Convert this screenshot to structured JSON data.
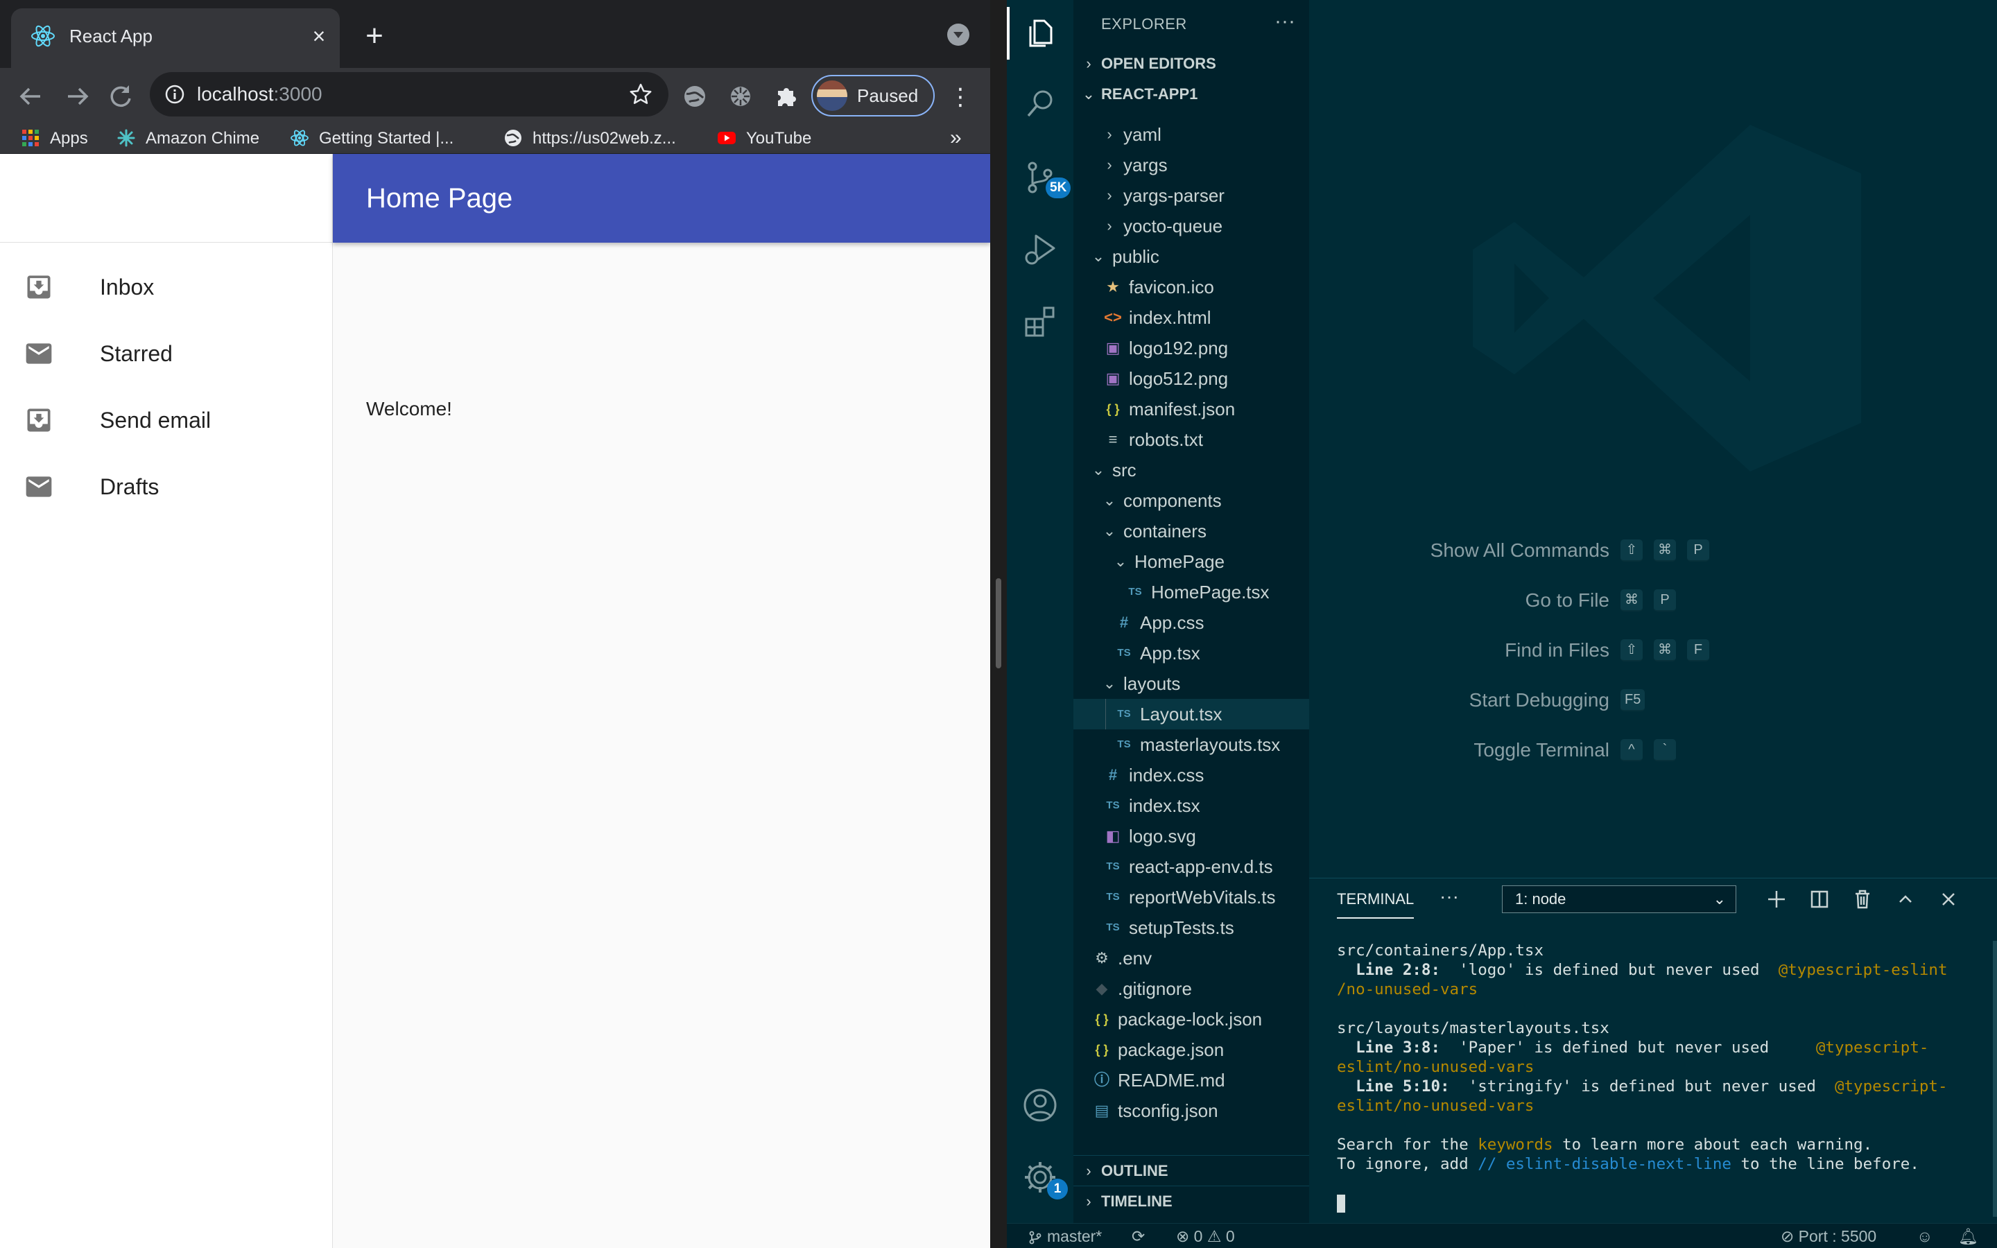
{
  "browser": {
    "tab_title": "React App",
    "new_tab_symbol": "+",
    "url_host": "localhost",
    "url_port": ":3000",
    "profile_status": "Paused",
    "bookmarks": [
      {
        "label": "Apps",
        "icon": "apps-grid-icon"
      },
      {
        "label": "Amazon Chime",
        "icon": "amazon-chime-icon"
      },
      {
        "label": "Getting Started |...",
        "icon": "react-icon"
      },
      {
        "label": "https://us02web.z...",
        "icon": "globe-icon"
      },
      {
        "label": "YouTube",
        "icon": "youtube-icon"
      }
    ],
    "bookmarks_more": "»"
  },
  "app": {
    "appbar_title": "Home Page",
    "welcome": "Welcome!",
    "drawer_items": [
      {
        "label": "Inbox",
        "icon": "inbox-icon"
      },
      {
        "label": "Starred",
        "icon": "mail-icon"
      },
      {
        "label": "Send email",
        "icon": "inbox-icon"
      },
      {
        "label": "Drafts",
        "icon": "mail-icon"
      }
    ]
  },
  "vscode": {
    "explorer_title": "EXPLORER",
    "sections": {
      "open_editors": "OPEN EDITORS",
      "project": "REACT-APP1",
      "outline": "OUTLINE",
      "timeline": "TIMELINE"
    },
    "source_control_badge": "5K",
    "settings_badge": "1",
    "tree": [
      {
        "label": "yaml",
        "type": "folder",
        "depth": 2,
        "expanded": false
      },
      {
        "label": "yargs",
        "type": "folder",
        "depth": 2,
        "expanded": false
      },
      {
        "label": "yargs-parser",
        "type": "folder",
        "depth": 2,
        "expanded": false
      },
      {
        "label": "yocto-queue",
        "type": "folder",
        "depth": 2,
        "expanded": false
      },
      {
        "label": "public",
        "type": "folder",
        "depth": 1,
        "expanded": true
      },
      {
        "label": "favicon.ico",
        "type": "favicon",
        "depth": 2
      },
      {
        "label": "index.html",
        "type": "html",
        "depth": 2
      },
      {
        "label": "logo192.png",
        "type": "image",
        "depth": 2
      },
      {
        "label": "logo512.png",
        "type": "image",
        "depth": 2
      },
      {
        "label": "manifest.json",
        "type": "json",
        "depth": 2
      },
      {
        "label": "robots.txt",
        "type": "text",
        "depth": 2
      },
      {
        "label": "src",
        "type": "folder",
        "depth": 1,
        "expanded": true
      },
      {
        "label": "components",
        "type": "folder",
        "depth": 2,
        "expanded": true
      },
      {
        "label": "containers",
        "type": "folder",
        "depth": 2,
        "expanded": true
      },
      {
        "label": "HomePage",
        "type": "folder",
        "depth": 3,
        "expanded": true
      },
      {
        "label": "HomePage.tsx",
        "type": "ts",
        "depth": 4
      },
      {
        "label": "App.css",
        "type": "css",
        "depth": 3
      },
      {
        "label": "App.tsx",
        "type": "ts",
        "depth": 3
      },
      {
        "label": "layouts",
        "type": "folder",
        "depth": 2,
        "expanded": true
      },
      {
        "label": "Layout.tsx",
        "type": "ts",
        "depth": 3,
        "selected": true
      },
      {
        "label": "masterlayouts.tsx",
        "type": "ts",
        "depth": 3
      },
      {
        "label": "index.css",
        "type": "css",
        "depth": 2
      },
      {
        "label": "index.tsx",
        "type": "ts",
        "depth": 2
      },
      {
        "label": "logo.svg",
        "type": "svg",
        "depth": 2
      },
      {
        "label": "react-app-env.d.ts",
        "type": "ts",
        "depth": 2
      },
      {
        "label": "reportWebVitals.ts",
        "type": "ts",
        "depth": 2
      },
      {
        "label": "setupTests.ts",
        "type": "ts",
        "depth": 2
      },
      {
        "label": ".env",
        "type": "gear",
        "depth": 1
      },
      {
        "label": ".gitignore",
        "type": "git",
        "depth": 1
      },
      {
        "label": "package-lock.json",
        "type": "json",
        "depth": 1
      },
      {
        "label": "package.json",
        "type": "json",
        "depth": 1
      },
      {
        "label": "README.md",
        "type": "info",
        "depth": 1
      },
      {
        "label": "tsconfig.json",
        "type": "tsconfig",
        "depth": 1
      }
    ],
    "commands": [
      {
        "label": "Show All Commands",
        "keys": [
          "⇧",
          "⌘",
          "P"
        ]
      },
      {
        "label": "Go to File",
        "keys": [
          "⌘",
          "P"
        ]
      },
      {
        "label": "Find in Files",
        "keys": [
          "⇧",
          "⌘",
          "F"
        ]
      },
      {
        "label": "Start Debugging",
        "keys": [
          "F5"
        ]
      },
      {
        "label": "Toggle Terminal",
        "keys": [
          "^",
          "`"
        ]
      }
    ],
    "panel": {
      "tab": "TERMINAL",
      "more": "···",
      "terminal_select": "1: node"
    },
    "terminal": {
      "l1": "src/containers/App.tsx",
      "l2a": "  Line 2:8:",
      "l2b": "  'logo' is defined but never used  ",
      "l2c": "@typescript-eslint",
      "l3": "/no-unused-vars",
      "l5": "src/layouts/masterlayouts.tsx",
      "l6a": "  Line 3:8:",
      "l6b": "  'Paper' is defined but never used     ",
      "l6c": "@typescript-",
      "l7": "eslint/no-unused-vars",
      "l8a": "  Line 5:10:",
      "l8b": "  'stringify' is defined but never used  ",
      "l8c": "@typescript-",
      "l9": "eslint/no-unused-vars",
      "l11a": "Search for the ",
      "l11b": "keywords",
      "l11c": " to learn more about each warning.",
      "l12a": "To ignore, add ",
      "l12b": "// eslint-disable-next-line",
      "l12c": " to the line before."
    },
    "status": {
      "branch": "master*",
      "errors": "0",
      "warnings": "0",
      "port": "Port : 5500"
    },
    "colors": {
      "accent": "#268bd2",
      "warning": "#b58900",
      "appbar": "#3f51b5"
    }
  }
}
